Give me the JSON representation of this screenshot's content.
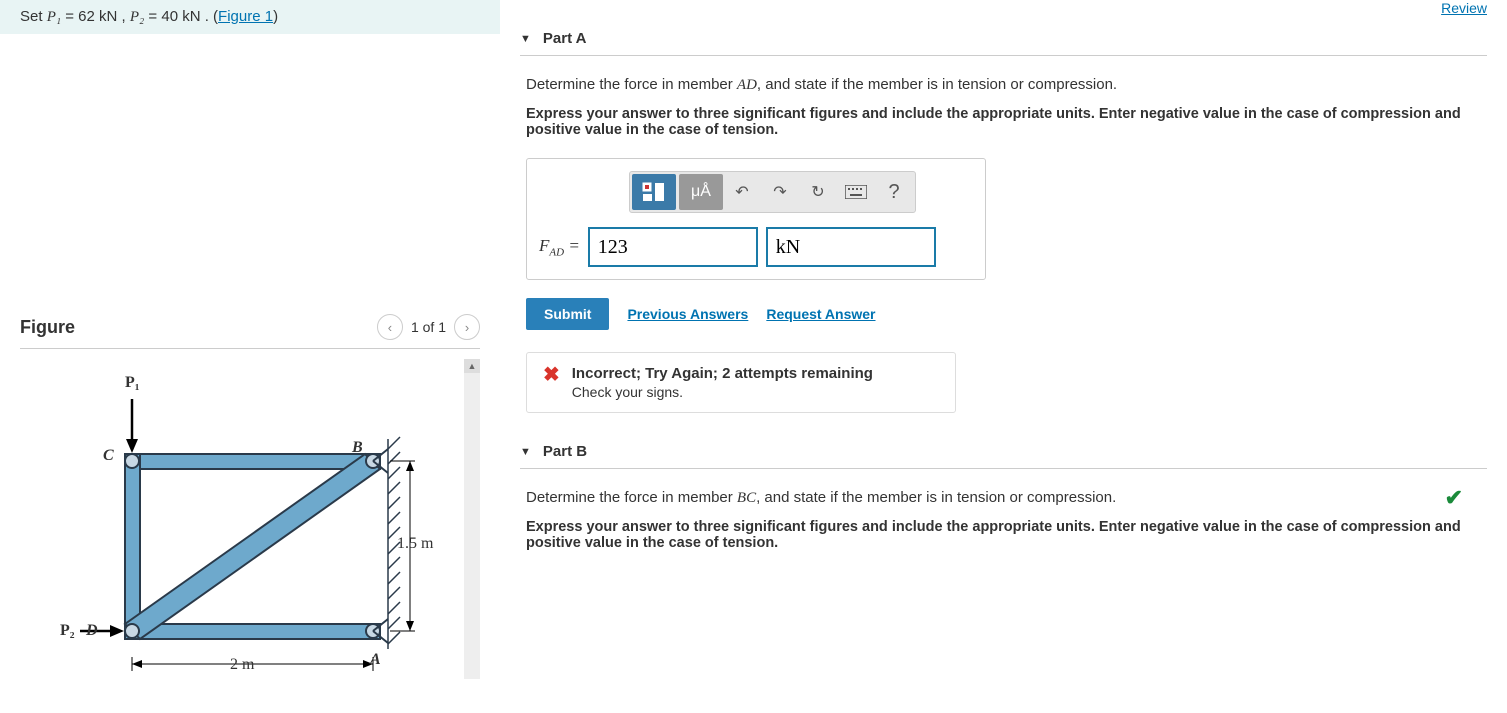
{
  "topnav": {
    "review": "Review"
  },
  "problem": {
    "setup_prefix": "Set ",
    "p1_var": "P₁",
    "p1_val": " = 62  kN , ",
    "p2_var": "P₂",
    "p2_val": " = 40  kN . (",
    "fig_link": "Figure 1",
    "close": ")"
  },
  "figure": {
    "title": "Figure",
    "counter": "1 of 1",
    "labels": {
      "P1": "P₁",
      "P2": "P₂",
      "B": "B",
      "C": "C",
      "D": "D",
      "A": "A",
      "w": "2 m",
      "h": "1.5 m"
    }
  },
  "partA": {
    "title": "Part A",
    "prompt_pre": "Determine the force in member ",
    "prompt_mem": "AD",
    "prompt_post": ", and state if the member is in tension or compression.",
    "instruction": "Express your answer to three significant figures and include the appropriate units. Enter negative value in the case of compression and positive value in the case of tension.",
    "label_var": "F",
    "label_sub": "AD",
    "value": "123",
    "unit": "kN",
    "submit": "Submit",
    "prev": "Previous Answers",
    "req": "Request Answer",
    "feedback_main": "Incorrect; Try Again; 2 attempts remaining",
    "feedback_sub": "Check your signs."
  },
  "partB": {
    "title": "Part B",
    "prompt_pre": "Determine the force in member ",
    "prompt_mem": "BC",
    "prompt_post": ", and state if the member is in tension or compression.",
    "instruction": "Express your answer to three significant figures and include the appropriate units. Enter negative value in the case of compression and positive value in the case of tension."
  },
  "toolbar": {
    "units_alpha": "μÅ",
    "help": "?"
  }
}
